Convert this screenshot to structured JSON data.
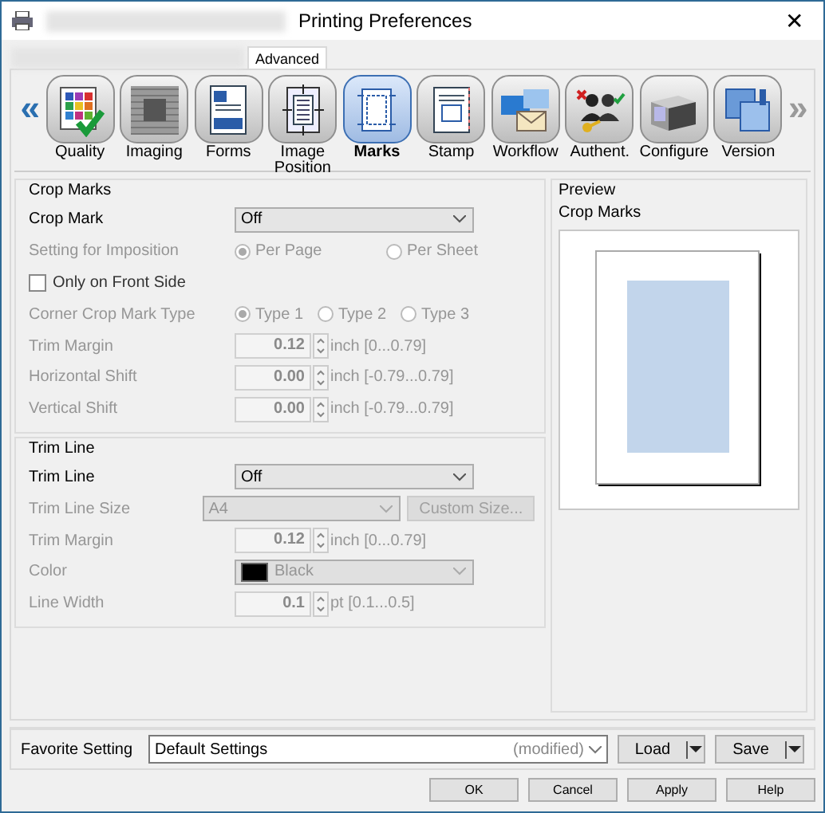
{
  "window": {
    "title": "Printing Preferences",
    "close": "✕"
  },
  "tabs": [
    {
      "label": "Advanced",
      "selected": true
    }
  ],
  "toolbar": {
    "prev": "«",
    "next": "»",
    "items": [
      {
        "label": "Quality",
        "selected": false
      },
      {
        "label": "Imaging",
        "selected": false
      },
      {
        "label": "Forms",
        "selected": false
      },
      {
        "label": "Image Position",
        "selected": false
      },
      {
        "label": "Marks",
        "selected": true
      },
      {
        "label": "Stamp",
        "selected": false
      },
      {
        "label": "Workflow",
        "selected": false
      },
      {
        "label": "Authent.",
        "selected": false
      },
      {
        "label": "Configure",
        "selected": false
      },
      {
        "label": "Version",
        "selected": false
      }
    ]
  },
  "groups": [
    {
      "title": "Crop Marks",
      "rows": [
        {
          "kind": "select",
          "label": "Crop Mark",
          "value": "Off",
          "disabled": false
        },
        {
          "kind": "radio",
          "label": "Setting for Imposition",
          "disabled": true,
          "options": [
            {
              "label": "Per Page",
              "selected": true
            },
            {
              "label": "Per Sheet",
              "selected": false
            }
          ]
        },
        {
          "kind": "checkbox",
          "label": "Only on Front Side",
          "checked": false,
          "disabled": false
        },
        {
          "kind": "radio",
          "label": "Corner Crop Mark Type",
          "disabled": true,
          "options": [
            {
              "label": "Type 1",
              "selected": true
            },
            {
              "label": "Type 2",
              "selected": false
            },
            {
              "label": "Type 3",
              "selected": false
            }
          ]
        },
        {
          "kind": "spin",
          "label": "Trim Margin",
          "value": "0.12",
          "unit": "inch [0...0.79]",
          "disabled": true
        },
        {
          "kind": "spin",
          "label": "Horizontal Shift",
          "value": "0.00",
          "unit": "inch [-0.79...0.79]",
          "disabled": true
        },
        {
          "kind": "spin",
          "label": "Vertical Shift",
          "value": "0.00",
          "unit": "inch [-0.79...0.79]",
          "disabled": true
        }
      ]
    },
    {
      "title": "Trim Line",
      "rows": [
        {
          "kind": "select",
          "label": "Trim Line",
          "value": "Off",
          "disabled": false
        },
        {
          "kind": "select",
          "label": "Trim Line Size",
          "value": "A4",
          "disabled": true,
          "button": "Custom Size..."
        },
        {
          "kind": "spin",
          "label": "Trim Margin",
          "value": "0.12",
          "unit": "inch [0...0.79]",
          "disabled": true
        },
        {
          "kind": "color",
          "label": "Color",
          "value": "Black",
          "disabled": true
        },
        {
          "kind": "spin",
          "label": "Line Width",
          "value": "0.1",
          "unit": "pt [0.1...0.5]",
          "disabled": true
        }
      ]
    }
  ],
  "preview": {
    "title": "Preview",
    "label": "Crop Marks"
  },
  "favorite": {
    "label": "Favorite Setting",
    "value": "Default Settings",
    "note": "(modified)",
    "buttons": [
      "Load",
      "Save"
    ]
  },
  "buttons": [
    "OK",
    "Cancel",
    "Apply",
    "Help"
  ]
}
